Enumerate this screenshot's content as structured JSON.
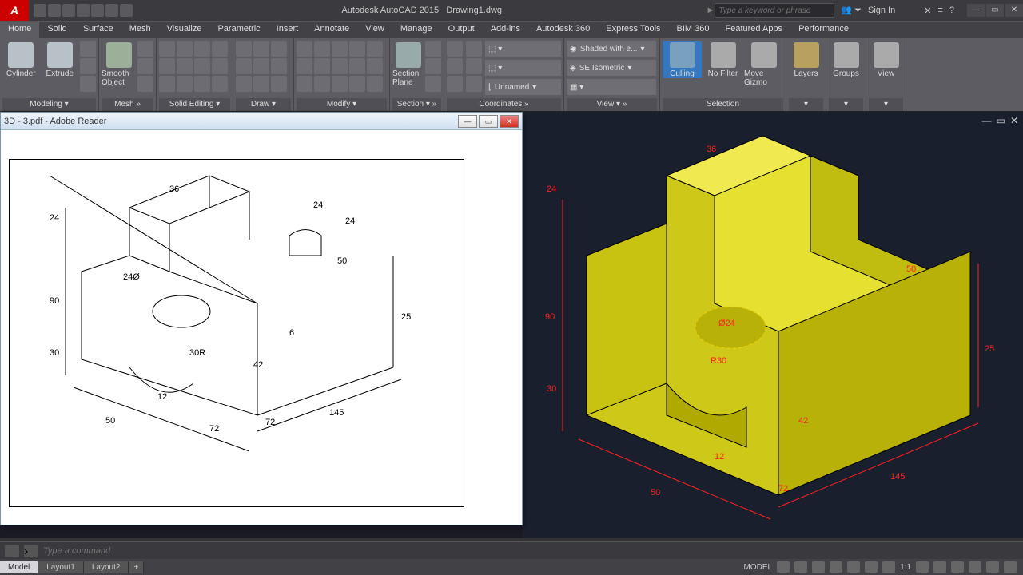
{
  "title": {
    "app": "Autodesk AutoCAD 2015",
    "file": "Drawing1.dwg",
    "search_ph": "Type a keyword or phrase",
    "signin": "Sign In"
  },
  "menu": [
    "Home",
    "Solid",
    "Surface",
    "Mesh",
    "Visualize",
    "Parametric",
    "Insert",
    "Annotate",
    "View",
    "Manage",
    "Output",
    "Add-ins",
    "Autodesk 360",
    "Express Tools",
    "BIM 360",
    "Featured Apps",
    "Performance"
  ],
  "ribbon": {
    "cylinder": "Cylinder",
    "extrude": "Extrude",
    "smooth": "Smooth Object",
    "section": "Section Plane",
    "culling": "Culling",
    "nofilter": "No Filter",
    "movegizmo": "Move Gizmo",
    "layers": "Layers",
    "groups": "Groups",
    "view": "View",
    "panel_modeling": "Modeling ▾",
    "panel_mesh": "Mesh   »",
    "panel_solid": "Solid Editing ▾",
    "panel_draw": "Draw ▾",
    "panel_modify": "Modify ▾",
    "panel_section": "Section ▾ »",
    "panel_coord": "Coordinates   »",
    "panel_view": "View ▾   »",
    "panel_selection": "Selection",
    "panel_layers": "▾",
    "panel_groups": "▾",
    "panel_viewp": "▾",
    "vis_style": "Shaded with e...",
    "vis_iso": "SE Isometric",
    "coord_name": "Unnamed"
  },
  "pdf": {
    "title": "3D - 3.pdf - Adobe Reader"
  },
  "dims": {
    "d24": "24",
    "d36": "36",
    "d90": "90",
    "d24b": "24",
    "d24dia": "24Ø",
    "d50": "50",
    "d25": "25",
    "d30": "30",
    "d30r": "30R",
    "d42": "42",
    "d6": "6",
    "d12": "12",
    "d72": "72",
    "d72b": "72",
    "d145": "145",
    "d50b": "50"
  },
  "dim3d": {
    "d24": "24",
    "d36": "36",
    "d90": "90",
    "d50": "50",
    "d25": "25",
    "d30": "30",
    "d42": "42",
    "d12": "12",
    "d72": "72",
    "d145": "145",
    "d50b": "50",
    "d24dia": "Ø24",
    "d30r": "R30"
  },
  "cmd": {
    "ph": "Type a command"
  },
  "tabs": {
    "model": "Model",
    "l1": "Layout1",
    "l2": "Layout2",
    "plus": "+"
  },
  "status": {
    "model": "MODEL",
    "scale": "1:1"
  }
}
